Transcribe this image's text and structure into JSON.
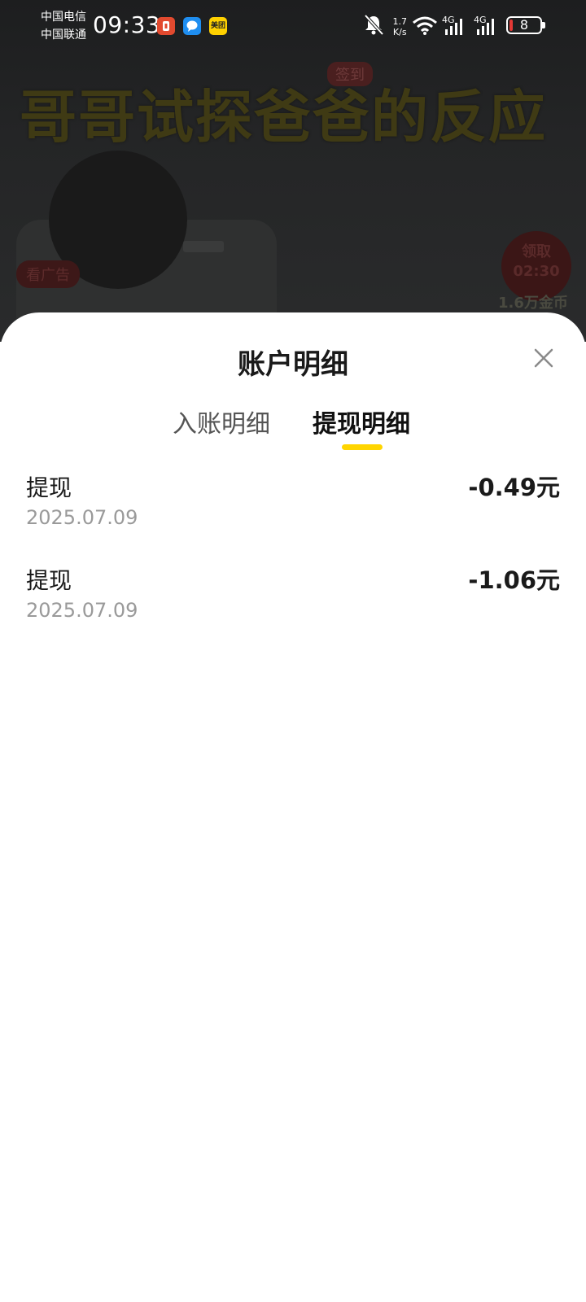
{
  "status_bar": {
    "carrier_1": "中国电信",
    "carrier_2": "中国联通",
    "time": "09:33",
    "notifications": [
      {
        "icon": "red-app-icon",
        "label": ""
      },
      {
        "icon": "message-bubble-icon",
        "label": ""
      },
      {
        "icon": "meituan-app-icon",
        "label": "美团"
      }
    ],
    "net_speed_value": "1.7",
    "net_speed_unit": "K/s",
    "network_type_1": "4G",
    "network_type_2": "4G",
    "battery_level": "8"
  },
  "background_video": {
    "title": "哥哥试探爸爸的反应",
    "tag": "签到",
    "left_pill": "看广告",
    "timer_label": "领取",
    "timer": "02:30",
    "coins": "1.6万金币"
  },
  "sheet": {
    "title": "账户明细",
    "close_icon": "close-icon",
    "tabs": [
      {
        "label": "入账明细",
        "active": false
      },
      {
        "label": "提现明细",
        "active": true
      }
    ],
    "indicator_color": "#FFD500",
    "records": [
      {
        "title": "提现",
        "date": "2025.07.09",
        "amount": "-0.49元"
      },
      {
        "title": "提现",
        "date": "2025.07.09",
        "amount": "-1.06元"
      }
    ]
  }
}
